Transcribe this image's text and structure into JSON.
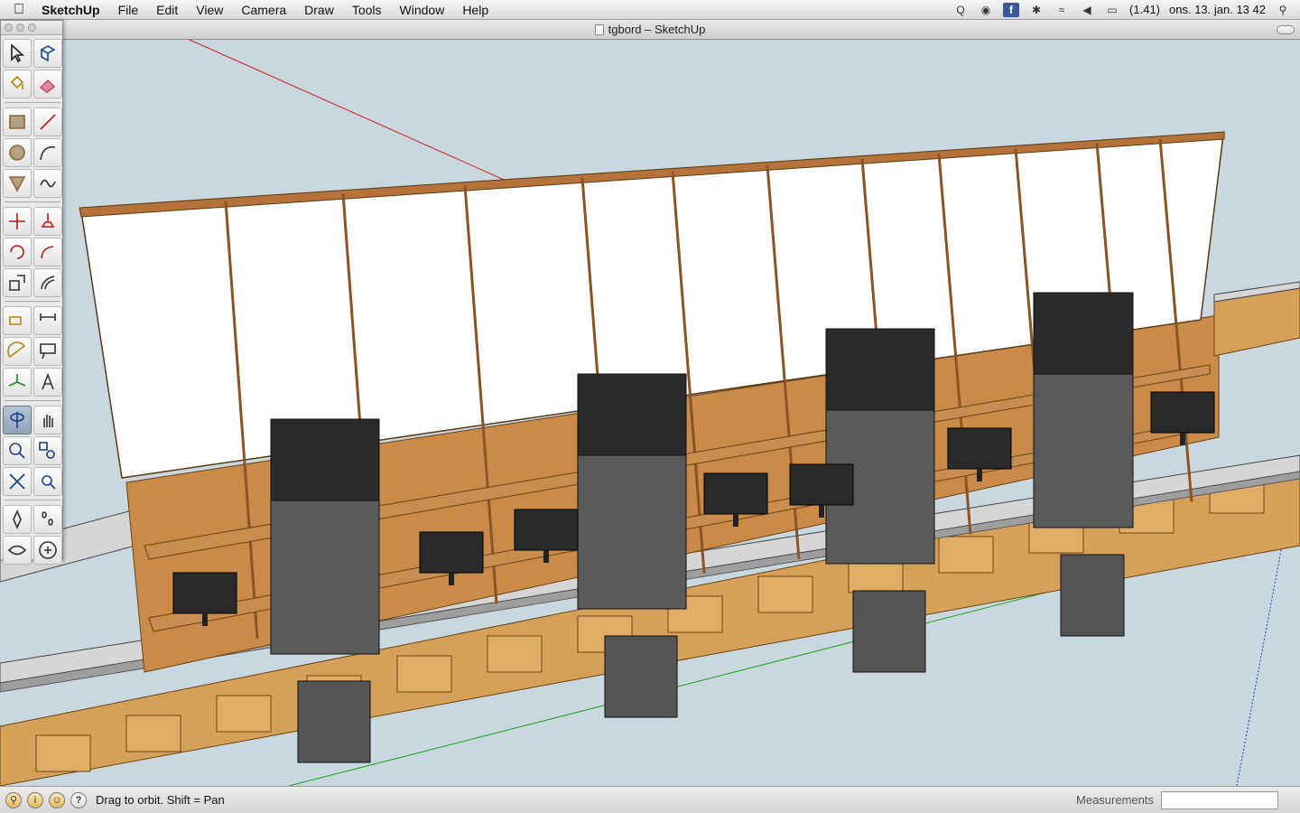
{
  "menubar": {
    "app_name": "SketchUp",
    "items": [
      "File",
      "Edit",
      "View",
      "Camera",
      "Draw",
      "Tools",
      "Window",
      "Help"
    ],
    "battery": "(1.41)",
    "clock": "ons. 13. jan.  13 42",
    "status_icons": [
      "quicksilver-icon",
      "webcam-icon",
      "facebook-icon",
      "bluetooth-icon",
      "wifi-icon",
      "volume-icon",
      "battery-icon",
      "spotlight-icon"
    ]
  },
  "window": {
    "title": "tgbord – SketchUp"
  },
  "palette": {
    "tools": [
      "select-icon",
      "component-icon",
      "paint-bucket-icon",
      "eraser-icon",
      "rectangle-icon",
      "line-icon",
      "circle-icon",
      "arc-icon",
      "polygon-icon",
      "freehand-icon",
      "move-icon",
      "push-pull-icon",
      "rotate-icon",
      "follow-me-icon",
      "scale-icon",
      "offset-icon",
      "tape-measure-icon",
      "dimension-icon",
      "protractor-icon",
      "text-icon",
      "axes-icon",
      "3d-text-icon",
      "orbit-icon",
      "pan-icon",
      "zoom-icon",
      "zoom-window-icon",
      "zoom-extents-icon",
      "previous-view-icon",
      "position-camera-icon",
      "walk-icon",
      "look-around-icon",
      "section-plane-icon"
    ],
    "active_tool": "orbit-icon"
  },
  "statusbar": {
    "hint": "Drag to orbit.  Shift = Pan",
    "measurements_label": "Measurements",
    "measurements_value": ""
  },
  "colors": {
    "sky": "#c9d7df",
    "wood": "#c8843a",
    "panel": "#ffffff",
    "speaker": "#555555",
    "table_top": "#d2d2d2"
  }
}
